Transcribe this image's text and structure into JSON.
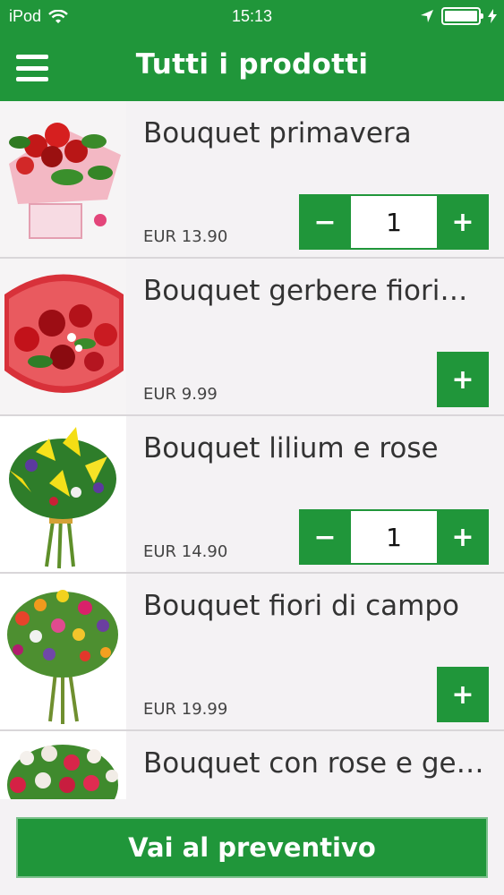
{
  "status_bar": {
    "carrier": "iPod",
    "time": "15:13",
    "battery_level": 1.0
  },
  "nav": {
    "title": "Tutti i prodotti",
    "menu_icon": "hamburger-menu-icon"
  },
  "products": [
    {
      "name": "Bouquet primavera",
      "price": "EUR 13.90",
      "quantity": "1",
      "has_quantity": true
    },
    {
      "name": "Bouquet gerbere fiori…",
      "price": "EUR 9.99",
      "quantity": "",
      "has_quantity": false
    },
    {
      "name": "Bouquet lilium e rose",
      "price": "EUR 14.90",
      "quantity": "1",
      "has_quantity": true
    },
    {
      "name": "Bouquet fiori di campo",
      "price": "EUR 19.99",
      "quantity": "",
      "has_quantity": false
    },
    {
      "name": "Bouquet con rose e ge…",
      "price": "",
      "quantity": "",
      "has_quantity": false
    }
  ],
  "stepper": {
    "minus_label": "−",
    "plus_label": "+"
  },
  "cta": {
    "label": "Vai al preventivo"
  },
  "colors": {
    "accent": "#20963a",
    "background": "#f4f2f4"
  }
}
